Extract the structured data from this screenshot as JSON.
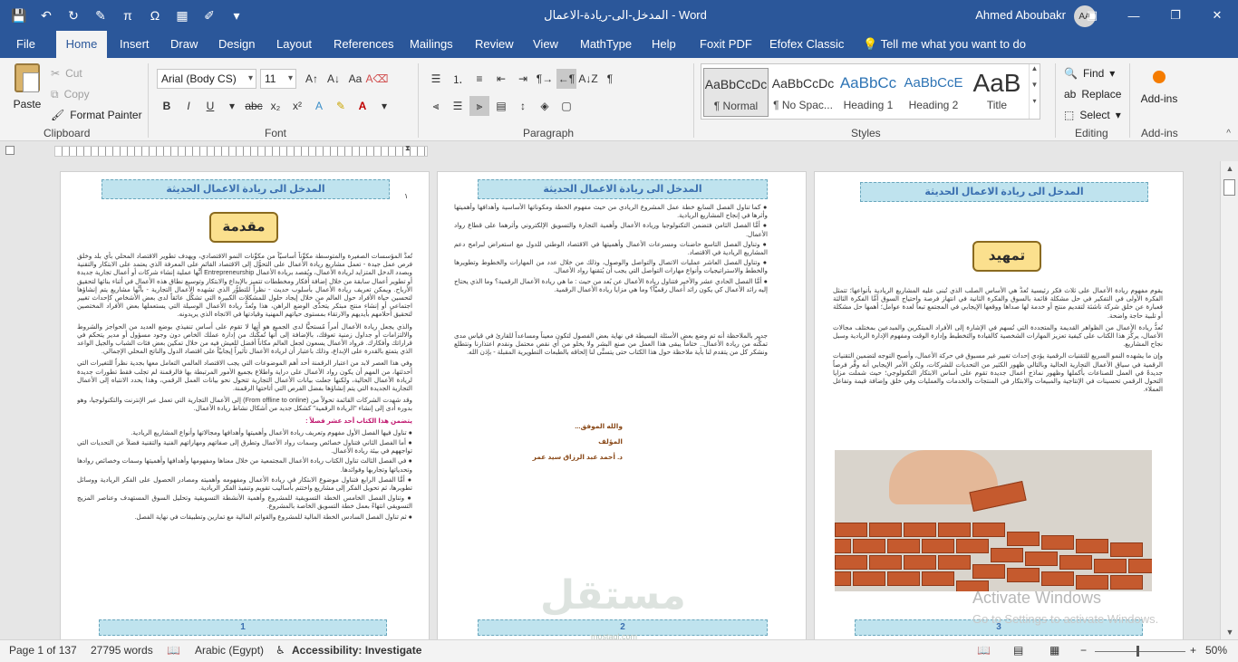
{
  "titlebar": {
    "document_title": "المدخل-الى-ريادة-الاعمال  -  Word",
    "user_name": "Ahmed Aboubakr",
    "user_initials": "AA"
  },
  "tabs": [
    "File",
    "Home",
    "Insert",
    "Draw",
    "Design",
    "Layout",
    "References",
    "Mailings",
    "Review",
    "View",
    "MathType",
    "Help",
    "Foxit PDF",
    "Efofex Classic"
  ],
  "tell_me": "Tell me what you want to do",
  "ribbon": {
    "clipboard": {
      "paste": "Paste",
      "cut": "Cut",
      "copy": "Copy",
      "format_painter": "Format Painter",
      "label": "Clipboard"
    },
    "font": {
      "family": "Arial (Body CS)",
      "size": "11",
      "label": "Font"
    },
    "paragraph": {
      "label": "Paragraph"
    },
    "styles": {
      "label": "Styles",
      "items": [
        {
          "preview": "AaBbCcDc",
          "name": "¶ Normal"
        },
        {
          "preview": "AaBbCcDc",
          "name": "¶ No Spac..."
        },
        {
          "preview": "AaBbCc",
          "name": "Heading 1"
        },
        {
          "preview": "AaBbCcE",
          "name": "Heading 2"
        },
        {
          "preview": "AaB",
          "name": "Title"
        }
      ]
    },
    "editing": {
      "find": "Find",
      "replace": "Replace",
      "select": "Select",
      "label": "Editing"
    },
    "addins": {
      "button": "Add-ins",
      "label": "Add-ins"
    }
  },
  "pages": {
    "header_banner": "المدخل الى ريادة الاعمال الحديثة",
    "p1": {
      "title": "مقدمة",
      "page_marker": "١",
      "paragraphs": [
        "تُعدُّ المؤسسات الصغيرة والمتوسطة مكوِّناً أساسيّاً من مكوِّنات النمو الاقتصادي، ويهدف تطوير الاقتصاد المحلي بأي بلد وخلق فرص عمل جيدة - تعمل مشاريع ريادة الأعمال على التحوُّل إلى الاقتصاد القائم على المعرفة الذي يعتمد على الابتكار والتقنية وبصدد الدخل المتزايد لريادة الأعمال، ويُقصد بريادة الأعمال Entrepreneurship أنَّها عملية إنشاء شركات أو أعمال تجارية جديدة أو تطوير أعمال سابقة من خلال إضافة أفكار ومخططات تتميز بالإبداع والابتكار وتوسيع نطاق هذه الأعمال في أثناء بنائها لتحقيق الأرباح. ويمكن تعريف ريادة الأعمال بأسلوب حديث - نظراً للتطوُّر الذي تشهده الأعمال التجارية - بأنَّها مشاريع يتم إنشاؤها لتحسين حياة الأفراد حول العالم من خلال إيجاد حلول للمشكلات الكبيرة التي تشكِّل عائقاً لدى بعض الأشخاص كإحداث تغيير اجتماعي أو إنشاء منتج مبتكر يتحدَّى الوضع الراهن، هذا وتُعدُّ ريادة الأعمال الوسيلة التي يستعملها بعض الأفراد المختصين لتحقيق أحلامهم بأيديهم والارتقاء بمستوى حياتهم المهنية وقيادتها في الاتجاه الذي يريدونه.",
        "والذي يجعل ريادة الأعمال أمراً مُستحيًّا لدى الجميع هو أنها لا تقوم على أساس تنفيذي بوضع العديد من الحواجز والشروط والالتزامات أو جداول زمنية تعوقك، بالإضافة إلى أنها تُمكِّنك من إدارة عملك الخاص دون وجود مسؤول أو مدير يتحكم في قراراتك وأفكارك. فرواد الأعمال يسعون لجعل العالم مكاناً أفضل للعيش فيه من خلال تمكين بعض فئات الشباب والجيل الواعد الذي يتمتع بالقدرة على الإبداع، وذلك باعتبار أن لريادة الأعمال تأثيراً إيجابيّاً على اقتصاد الدول والناتج المحلي الإجمالي.",
        "وفي هذا العصر لابد من اعتبار الرقمنة أحد أهم الموضوعات التي يجب الاقتصاد العالمي التعامل معها بجدية نظراً للتغيرات التي أحدثتها، من المهم أن يكون رواد الأعمال على دراية واطلاع بجميع الأمور المرتبطة بها فالرقمنة لم تجلب فقط تطورات جديدة لريادة الأعمال الحالية، ولكنها جعلت بيانات الأعمال التجارية تتحول نحو بيانات العمل الرقمي، وهذا يحدد الانتباه إلى الأعمال التجارية الجديدة التي يتم إنشاؤها بفضل الفرص التي أتاحتها الرقمنة.",
        "وقد شهدت الشركات القائمة تحولاً من (From offline to online) إلى الأعمال التجارية التي تعمل عبر الإنترنت والتكنولوجيا، وهو بدوره أدى إلى إنشاء \"الريادة الرقمية\" كشكل جديد من أشكال نشاط ريادة الأعمال."
      ],
      "list_title": "يتضمن هذا الكتاب أحد عشر فصلاً :",
      "list": [
        "تناول فيها الفصل الأول مفهوم وتعريف ريادة الأعمال وأهميتها وأهدافها ومجالاتها وأنواع المشاريع الريادية.",
        "أما الفصل الثاني فتناول خصائص وسمات رواد الأعمال وتطرق إلى صفاتهم ومهاراتهم الفنية والتقنية فضلاً عن التحديات التي تواجههم في بيئة ريادة الأعمال.",
        "في الفصل الثالث تناول الكتاب ريادة الأعمال المجتمعية من خلال معناها ومفهومها وأهدافها وأهميتها وسمات وخصائص روادها وتحدياتها وتجاربها وفوائدها.",
        "أمَّا الفصل الرابع فتناول موضوع الابتكار في ريادة الأعمال ومفهومه وأهميته ومصادر الحصول على الفكر الريادية ووسائل تطويرها، ثم تحويل الفكر إلى مشاريع واختتم بأساليب تقويم وتنفيذ الفكر الريادية.",
        "وتناول الفصل الخامس الخطة التسويقية للمشروع وأهمية الأنشطة التسويقية وتحليل السوق المستهدف وعناصر المزيج التسويقي انتهاءً بعمل خطة التسويق الخاصة بالمشروع.",
        "ثم تناول الفصل السادس الخطة المالية للمشروع والقوائم المالية مع تمارين وتطبيقات في نهاية الفصل."
      ],
      "footer": "1"
    },
    "p2": {
      "list": [
        "كما تناول الفصل السابع خطة عمل المشروع الريادي من حيث مفهوم الخطة ومكوناتها الأساسية وأهدافها وأهميتها وأثرها في إنجاح المشاريع الريادية.",
        "أمَّا الفصل الثامن فتضمن التكنولوجيا وريادة الأعمال وأهمية التجارة والتسويق الإلكتروني وأثرهما على قطاع رواد الأعمال.",
        "وتناول الفصل التاسع حاضنات ومسرعات الأعمال وأهميتها في الاقتصاد الوطني للدول مع استعراض لبرامج دعم المشاريع الريادية في الاقتصاد.",
        "وتناول الفصل العاشر عمليات الاتصال والتواصل والوصول، وذلك من خلال عدد من المهارات والخطوط وتطويرها والخطط والاستراتيجيات وأنواع مهارات التواصل التي يجب أن يُتقنها رواد الأعمال.",
        "أمَّا الفصل الحادي عشر والأخير فتناول ريادة الأعمال عن بُعد من حيث : ما هي ريادة الأعمال الرقمية؟ وما الذي يحتاج إليه رائد الأعمال كي يكون رائد أعمال رقميّاً؟ وما هي مزايا ريادة الأعمال الرقمية."
      ],
      "closing": "جدير بالملاحظة أنه تم وضع بعض الأسئلة البسيطة في نهاية بعض الفصول لتكون معيناً ومساعداً للقارئ في قياس مدى تمكُّنه من ريادة الأعمال.. ختاماً يبقى هذا العمل من صنع البشر ولا يخلو من أي نقص محتمل ونقدم اعتذارنا ونتطلع ونشكر كل من يتقدم لنا بأية ملاحظة حول هذا الكتاب حتى يتسنَّى لنا إلحاقه بالطبعات التطويرية المقبلة - بإذن الله.",
      "sig1": "والله الموفق...",
      "sig2": "المؤلف",
      "sig3": "د. أحمد عبد الرزاق سيد عمر",
      "footer": "2"
    },
    "p3": {
      "title": "تمهيد",
      "paragraphs": [
        "يقوم مفهوم ريادة الأعمال على ثلاث فكر رئيسية تُعدُّ هي الأساس الصلب الذي تُبنى عليه المشاريع الريادية بأنواعها؛ تتمثل الفكرة الأولى في التفكير في حل مشكلة قائمة بالسوق والفكرة الثانية في انتهاز فرصة واحتياج السوق أمَّا الفكرة الثالثة فعبارة عن خلق شركة ناشئة لتقديم منتج أو خدمة لها صداها ووقعها الإيجابي في المجتمع تبعاً لعدة عوامل؛ أهمها حل مشكلة أو تلبية حاجة واضحة.",
        "تُعدُّ ريادة الأعمال من الظواهر القديمة والمتجددة التي تُسهم في الإشارة إلى الأفراد المبتكرين والمبدعين بمختلف مجالات الأعمال، يركِّز هذا الكتاب على كيفية تعزيز المهارات الشخصية كالقيادة والتخطيط وإدارة الوقت ومفهوم الإدارة الريادية وسبل نجاح المشاريع.",
        "وإن ما يشهده النمو السريع للتقنيات الرقمية يؤدي إحداث تغيير غير مسبوق في حركة الأعمال، وأصبح التوجه لتضمين التقنيات الرقمية في سياق الأعمال التجارية الحالية وبالتالي ظهور الكثير من التحديات للشركات، ولكن الأمر الإيجابي أنه وفَّر فرصاً جديدةً في العمل للصناعات بأكملها وظهور نماذج أعمال جديدة تقوم على أساس الابتكار التكنولوجي؛ حيث شملت مزايا التحول الرقمي تحسينات في الإنتاجية والمبيعات والابتكار في المنتجات والخدمات والعمليات وفي خلق وإضافة قيمة وتفاعل العملاء."
      ],
      "footer": "3"
    }
  },
  "watermark": {
    "title": "Activate Windows",
    "subtitle": "Go to Settings to activate Windows."
  },
  "site_logo": "مستقل",
  "site_logo_sub": "mostaql.com",
  "status": {
    "page": "Page 1 of 137",
    "words": "27795 words",
    "language": "Arabic (Egypt)",
    "accessibility": "Accessibility: Investigate",
    "zoom": "50%"
  },
  "colors": {
    "accent": "#2b579a",
    "banner": "#bfe3ee",
    "gold": "#fbe08e"
  }
}
